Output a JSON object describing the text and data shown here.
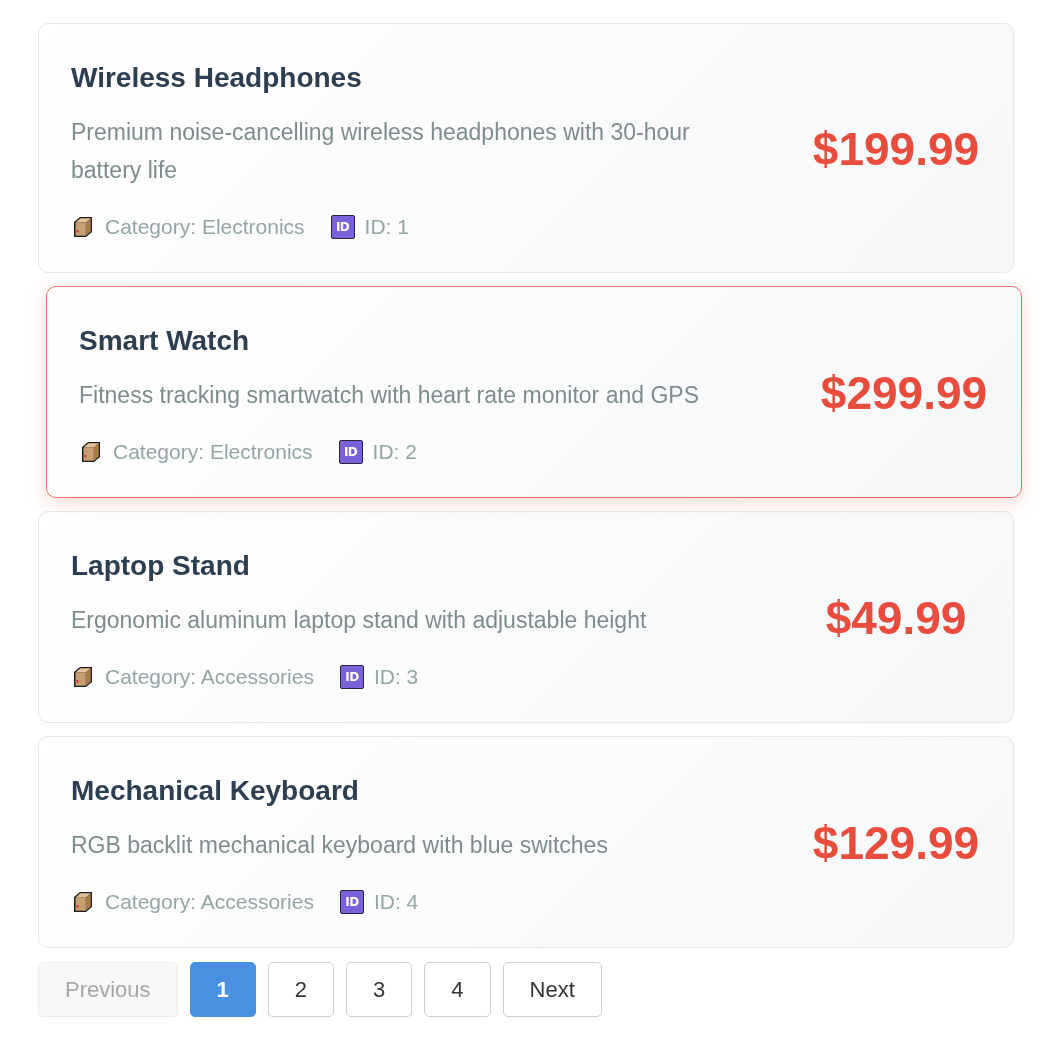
{
  "products": [
    {
      "name": "Wireless Headphones",
      "description": "Premium noise-cancelling wireless headphones with 30-hour battery life",
      "price": "$199.99",
      "highlighted": false,
      "meta": [
        {
          "kind": "category",
          "text": "Category: Electronics"
        },
        {
          "kind": "id",
          "badge": "ID",
          "text": "ID: 1"
        }
      ]
    },
    {
      "name": "Smart Watch",
      "description": "Fitness tracking smartwatch with heart rate monitor and GPS",
      "price": "$299.99",
      "highlighted": true,
      "meta": [
        {
          "kind": "category",
          "text": "Category: Electronics"
        },
        {
          "kind": "id",
          "badge": "ID",
          "text": "ID: 2"
        }
      ]
    },
    {
      "name": "Laptop Stand",
      "description": "Ergonomic aluminum laptop stand with adjustable height",
      "price": "$49.99",
      "highlighted": false,
      "meta": [
        {
          "kind": "category",
          "text": "Category: Accessories"
        },
        {
          "kind": "id",
          "badge": "ID",
          "text": "ID: 3"
        }
      ]
    },
    {
      "name": "Mechanical Keyboard",
      "description": "RGB backlit mechanical keyboard with blue switches",
      "price": "$129.99",
      "highlighted": false,
      "meta": [
        {
          "kind": "category",
          "text": "Category: Accessories"
        },
        {
          "kind": "id",
          "badge": "ID",
          "text": "ID: 4"
        }
      ]
    }
  ],
  "pagination": {
    "previous": {
      "label": "Previous",
      "disabled": true
    },
    "pages": [
      {
        "label": "1",
        "selected": true
      },
      {
        "label": "2",
        "selected": false
      },
      {
        "label": "3",
        "selected": false
      },
      {
        "label": "4",
        "selected": false
      }
    ],
    "next": {
      "label": "Next",
      "disabled": false
    }
  }
}
